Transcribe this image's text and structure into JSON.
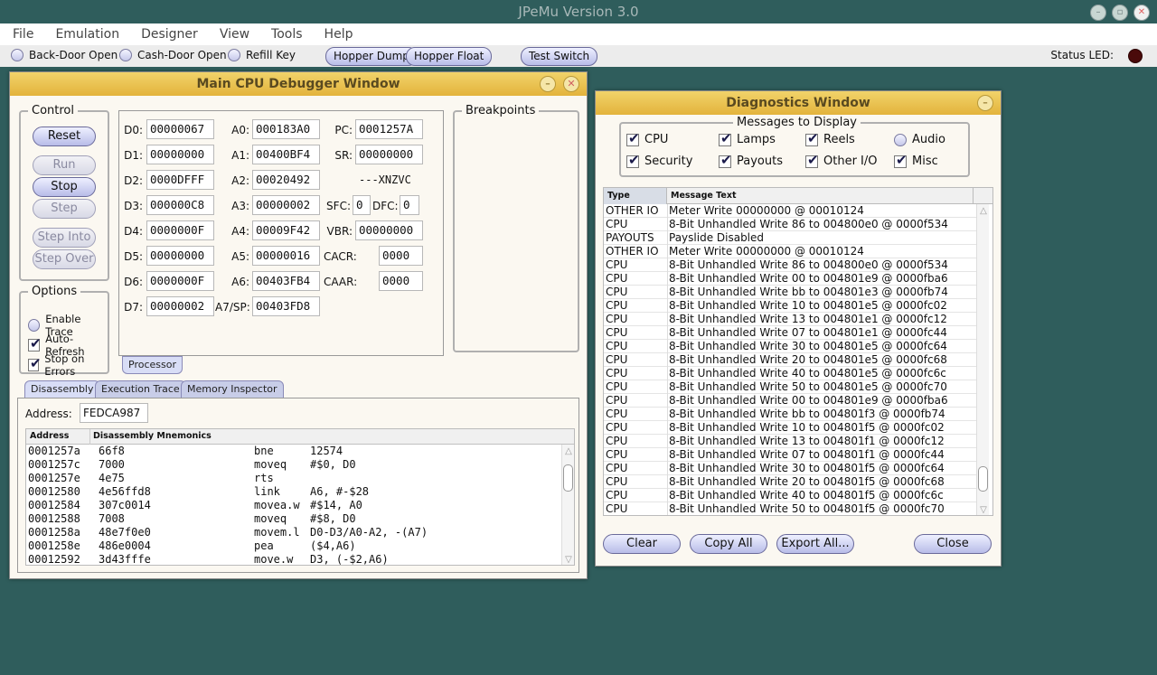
{
  "app": {
    "title": "JPeMu Version 3.0"
  },
  "menu": [
    "File",
    "Emulation",
    "Designer",
    "View",
    "Tools",
    "Help"
  ],
  "toolbar": {
    "back_door": "Back-Door Open",
    "cash_door": "Cash-Door Open",
    "refill_key": "Refill Key",
    "hopper_dump": "Hopper Dump",
    "hopper_float": "Hopper Float",
    "test_switch": "Test Switch",
    "status_led": "Status LED:"
  },
  "cpu_window": {
    "title": "Main CPU Debugger Window",
    "control_label": "Control",
    "buttons": {
      "reset": "Reset",
      "run": "Run",
      "stop": "Stop",
      "step": "Step",
      "step_into": "Step Into",
      "step_over": "Step Over"
    },
    "options_label": "Options",
    "options": {
      "enable_trace": "Enable Trace",
      "auto_refresh": "Auto-Refresh",
      "stop_on_errors": "Stop on Errors"
    },
    "registers": {
      "d": [
        [
          "D0:",
          "00000067"
        ],
        [
          "D1:",
          "00000000"
        ],
        [
          "D2:",
          "0000DFFF"
        ],
        [
          "D3:",
          "000000C8"
        ],
        [
          "D4:",
          "0000000F"
        ],
        [
          "D5:",
          "00000000"
        ],
        [
          "D6:",
          "0000000F"
        ],
        [
          "D7:",
          "00000002"
        ]
      ],
      "a": [
        [
          "A0:",
          "000183A0"
        ],
        [
          "A1:",
          "00400BF4"
        ],
        [
          "A2:",
          "00020492"
        ],
        [
          "A3:",
          "00000002"
        ],
        [
          "A4:",
          "00009F42"
        ],
        [
          "A5:",
          "00000016"
        ],
        [
          "A6:",
          "00403FB4"
        ],
        [
          "A7/SP:",
          "00403FD8"
        ]
      ],
      "pc_label": "PC:",
      "pc": "0001257A",
      "sr_label": "SR:",
      "sr": "00000000",
      "flags": "---XNZVC",
      "sfc_label": "SFC:",
      "sfc": "0",
      "dfc_label": "DFC:",
      "dfc": "0",
      "vbr_label": "VBR:",
      "vbr": "00000000",
      "cacr_label": "CACR:",
      "cacr": "0000",
      "caar_label": "CAAR:",
      "caar": "0000"
    },
    "processor_tab": "Processor",
    "breakpoints_label": "Breakpoints",
    "tabs": [
      "Disassembly",
      "Execution Trace",
      "Memory Inspector"
    ],
    "address_label": "Address:",
    "address_value": "FEDCA987",
    "disasm_headers": [
      "Address",
      "Disassembly Mnemonics"
    ],
    "disasm_rows": [
      [
        "0001257a",
        "66f8",
        "bne",
        "12574"
      ],
      [
        "0001257c",
        "7000",
        "moveq",
        "#$0, D0"
      ],
      [
        "0001257e",
        "4e75",
        "rts",
        ""
      ],
      [
        "00012580",
        "4e56ffd8",
        "link",
        "A6, #-$28"
      ],
      [
        "00012584",
        "307c0014",
        "movea.w",
        "#$14, A0"
      ],
      [
        "00012588",
        "7008",
        "moveq",
        "#$8, D0"
      ],
      [
        "0001258a",
        "48e7f0e0",
        "movem.l",
        "D0-D3/A0-A2, -(A7)"
      ],
      [
        "0001258e",
        "486e0004",
        "pea",
        "($4,A6)"
      ],
      [
        "00012592",
        "3d43fffe",
        "move.w",
        "D3, (-$2,A6)"
      ]
    ]
  },
  "diag_window": {
    "title": "Diagnostics Window",
    "messages_label": "Messages to Display",
    "filters": [
      {
        "label": "CPU",
        "checked": true
      },
      {
        "label": "Lamps",
        "checked": true
      },
      {
        "label": "Reels",
        "checked": true
      },
      {
        "label": "Audio",
        "checked": false
      },
      {
        "label": "Security",
        "checked": true
      },
      {
        "label": "Payouts",
        "checked": true
      },
      {
        "label": "Other I/O",
        "checked": true
      },
      {
        "label": "Misc",
        "checked": true
      }
    ],
    "headers": [
      "Type",
      "Message Text"
    ],
    "rows": [
      [
        "OTHER IO",
        "Meter Write 00000000 @ 00010124"
      ],
      [
        "CPU",
        "8-Bit Unhandled Write 86 to 004800e0 @ 0000f534"
      ],
      [
        "PAYOUTS",
        "Payslide Disabled"
      ],
      [
        "OTHER IO",
        "Meter Write 00000000 @ 00010124"
      ],
      [
        "CPU",
        "8-Bit Unhandled Write 86 to 004800e0 @ 0000f534"
      ],
      [
        "CPU",
        "8-Bit Unhandled Write 00 to 004801e9 @ 0000fba6"
      ],
      [
        "CPU",
        "8-Bit Unhandled Write bb to 004801e3 @ 0000fb74"
      ],
      [
        "CPU",
        "8-Bit Unhandled Write 10 to 004801e5 @ 0000fc02"
      ],
      [
        "CPU",
        "8-Bit Unhandled Write 13 to 004801e1 @ 0000fc12"
      ],
      [
        "CPU",
        "8-Bit Unhandled Write 07 to 004801e1 @ 0000fc44"
      ],
      [
        "CPU",
        "8-Bit Unhandled Write 30 to 004801e5 @ 0000fc64"
      ],
      [
        "CPU",
        "8-Bit Unhandled Write 20 to 004801e5 @ 0000fc68"
      ],
      [
        "CPU",
        "8-Bit Unhandled Write 40 to 004801e5 @ 0000fc6c"
      ],
      [
        "CPU",
        "8-Bit Unhandled Write 50 to 004801e5 @ 0000fc70"
      ],
      [
        "CPU",
        "8-Bit Unhandled Write 00 to 004801e9 @ 0000fba6"
      ],
      [
        "CPU",
        "8-Bit Unhandled Write bb to 004801f3 @ 0000fb74"
      ],
      [
        "CPU",
        "8-Bit Unhandled Write 10 to 004801f5 @ 0000fc02"
      ],
      [
        "CPU",
        "8-Bit Unhandled Write 13 to 004801f1 @ 0000fc12"
      ],
      [
        "CPU",
        "8-Bit Unhandled Write 07 to 004801f1 @ 0000fc44"
      ],
      [
        "CPU",
        "8-Bit Unhandled Write 30 to 004801f5 @ 0000fc64"
      ],
      [
        "CPU",
        "8-Bit Unhandled Write 20 to 004801f5 @ 0000fc68"
      ],
      [
        "CPU",
        "8-Bit Unhandled Write 40 to 004801f5 @ 0000fc6c"
      ],
      [
        "CPU",
        "8-Bit Unhandled Write 50 to 004801f5 @ 0000fc70"
      ]
    ],
    "buttons": {
      "clear": "Clear",
      "copy_all": "Copy All",
      "export_all": "Export All...",
      "close": "Close"
    }
  }
}
